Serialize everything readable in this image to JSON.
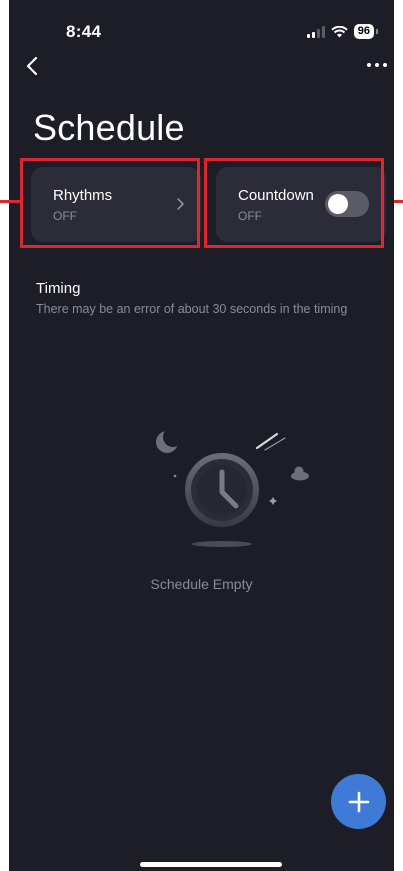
{
  "status_bar": {
    "time": "8:44",
    "battery": "96"
  },
  "page": {
    "title": "Schedule"
  },
  "cards": {
    "rhythms": {
      "title": "Rhythms",
      "state": "OFF"
    },
    "countdown": {
      "title": "Countdown",
      "state": "OFF",
      "toggle_on": false
    }
  },
  "timing": {
    "title": "Timing",
    "note": "There may be an error of about 30 seconds in the timing"
  },
  "empty_state": {
    "text": "Schedule Empty"
  },
  "colors": {
    "background": "#1c1d27",
    "card": "#2b2c37",
    "accent": "#3f7ad6",
    "highlight": "#d9282f"
  },
  "icons": [
    "back-icon",
    "more-icon",
    "chevron-right-icon",
    "plus-icon",
    "clock-icon",
    "moon-icon"
  ]
}
